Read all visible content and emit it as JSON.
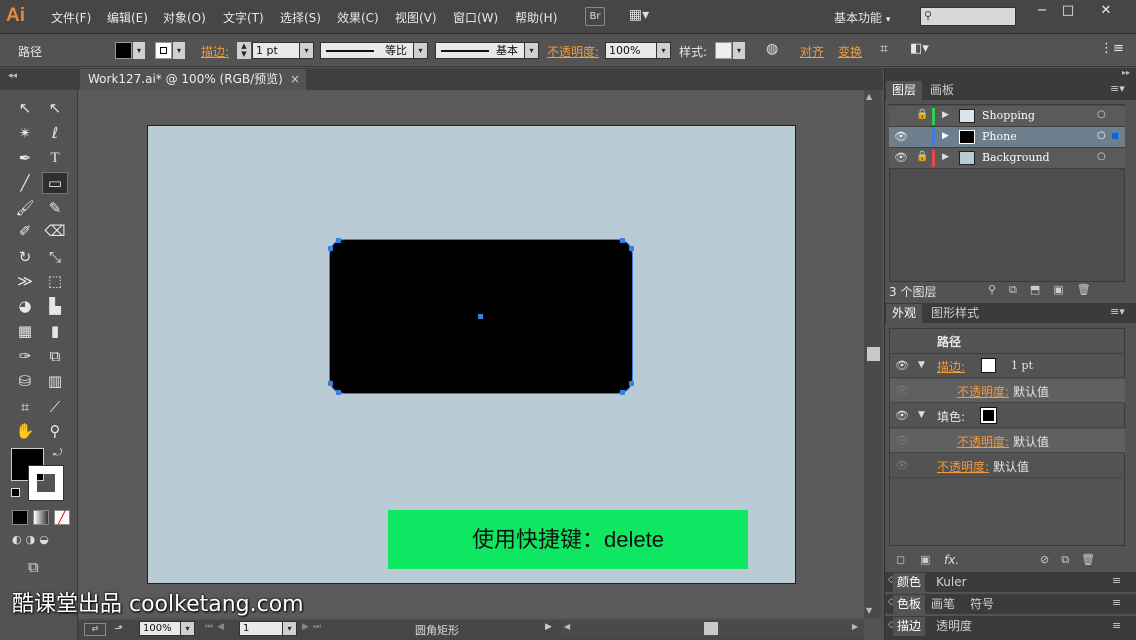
{
  "app": {
    "logo": "Ai"
  },
  "menu": {
    "items": [
      "文件(F)",
      "编辑(E)",
      "对象(O)",
      "文字(T)",
      "选择(S)",
      "效果(C)",
      "视图(V)",
      "窗口(W)",
      "帮助(H)"
    ],
    "bridge_label": "Br",
    "workspace": "基本功能",
    "window_controls": [
      "−",
      "□",
      "✕"
    ]
  },
  "control_bar": {
    "object_type": "路径",
    "stroke_label": "描边:",
    "stroke_weight": "1 pt",
    "profile_label": "等比",
    "brush_label": "基本",
    "opacity_label": "不透明度:",
    "opacity_value": "100%",
    "style_label": "样式:",
    "align_label": "对齐",
    "transform_label": "变换"
  },
  "document": {
    "tab_title": "Work127.ai* @ 100% (RGB/预览)",
    "close_glyph": "×"
  },
  "canvas": {
    "shape_fill": "#000000",
    "selection_color": "#3d7fe0",
    "artboard_color": "#b9ccd6",
    "banner_text": "使用快捷键：delete",
    "banner_color": "#0fe662"
  },
  "status_bar": {
    "zoom": "100%",
    "page": "1",
    "tool_status": "圆角矩形"
  },
  "watermark": "酷课堂出品 coolketang.com",
  "layers_panel": {
    "tabs": [
      "图层",
      "画板"
    ],
    "layers": [
      {
        "name": "Shopping",
        "color": "#2fcf4a",
        "visible": false,
        "locked": true
      },
      {
        "name": "Phone",
        "color": "#3d7fe0",
        "visible": true,
        "locked": false
      },
      {
        "name": "Background",
        "color": "#e04a4a",
        "visible": true,
        "locked": true
      }
    ],
    "count_label": "3 个图层"
  },
  "appearance_panel": {
    "tabs": [
      "外观",
      "图形样式"
    ],
    "title": "路径",
    "stroke_label": "描边:",
    "stroke_value": "1 pt",
    "opacity_label": "不透明度:",
    "default_value": "默认值",
    "fill_label": "填色:",
    "fx_label": "fx."
  },
  "bottom_panels": [
    {
      "tabs": [
        "颜色",
        "Kuler"
      ]
    },
    {
      "tabs": [
        "色板",
        "画笔",
        "符号"
      ]
    },
    {
      "tabs": [
        "描边",
        "透明度"
      ]
    }
  ]
}
